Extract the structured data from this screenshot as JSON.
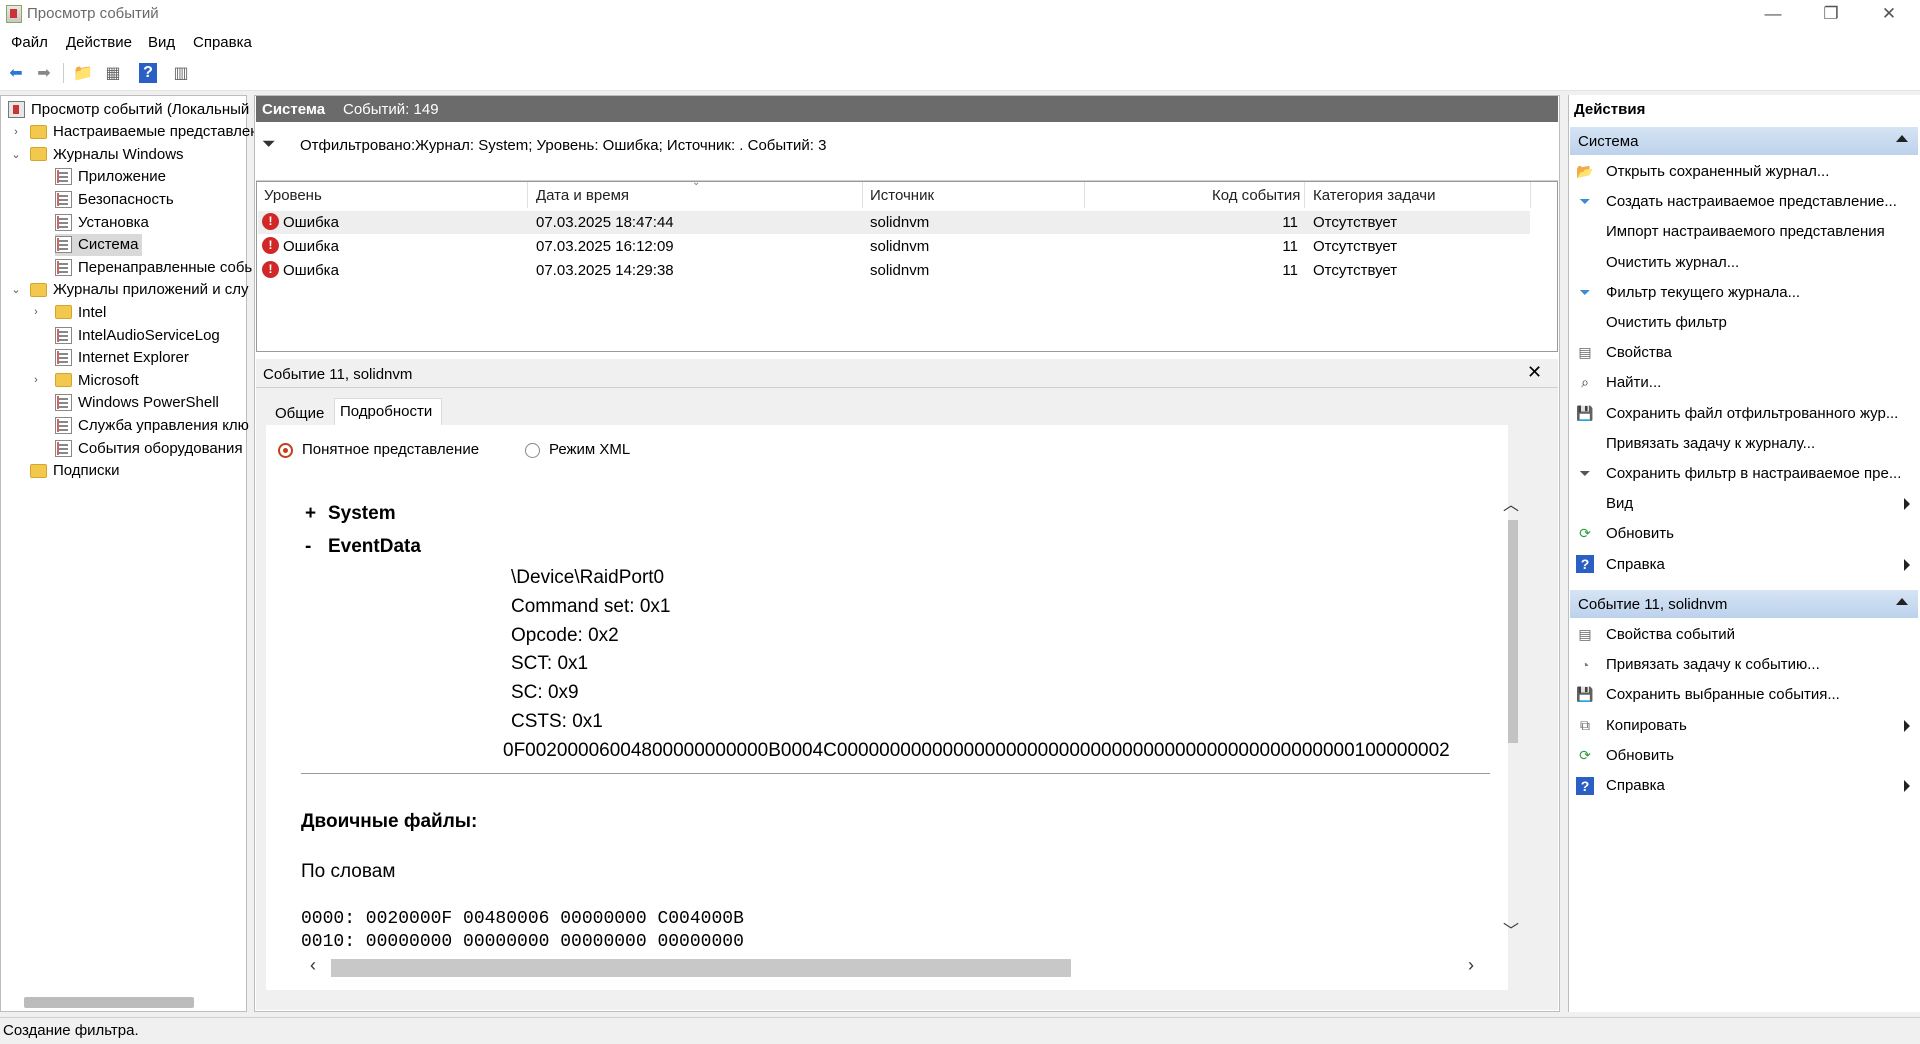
{
  "window": {
    "title": "Просмотр событий"
  },
  "menu": [
    "Файл",
    "Действие",
    "Вид",
    "Справка"
  ],
  "tree": {
    "items": [
      {
        "label": "Просмотр событий (Локальный",
        "depth": 0,
        "icon": "event-viewer-icon",
        "twisty": ""
      },
      {
        "label": "Настраиваемые представлен",
        "depth": 1,
        "icon": "folder-icon",
        "twisty": "›"
      },
      {
        "label": "Журналы Windows",
        "depth": 1,
        "icon": "folder-icon",
        "twisty": "⌄"
      },
      {
        "label": "Приложение",
        "depth": 2,
        "icon": "log-icon",
        "twisty": ""
      },
      {
        "label": "Безопасность",
        "depth": 2,
        "icon": "log-icon",
        "twisty": ""
      },
      {
        "label": "Установка",
        "depth": 2,
        "icon": "log-icon",
        "twisty": ""
      },
      {
        "label": "Система",
        "depth": 2,
        "icon": "log-icon",
        "twisty": "",
        "selected": true
      },
      {
        "label": "Перенаправленные собь",
        "depth": 2,
        "icon": "log-icon",
        "twisty": ""
      },
      {
        "label": "Журналы приложений и слу",
        "depth": 1,
        "icon": "folder-icon",
        "twisty": "⌄"
      },
      {
        "label": "Intel",
        "depth": 2,
        "icon": "folder-icon",
        "twisty": "›"
      },
      {
        "label": "IntelAudioServiceLog",
        "depth": 2,
        "icon": "log-icon",
        "twisty": ""
      },
      {
        "label": "Internet Explorer",
        "depth": 2,
        "icon": "log-icon",
        "twisty": ""
      },
      {
        "label": "Microsoft",
        "depth": 2,
        "icon": "folder-icon",
        "twisty": "›"
      },
      {
        "label": "Windows PowerShell",
        "depth": 2,
        "icon": "log-icon",
        "twisty": ""
      },
      {
        "label": "Служба управления клю",
        "depth": 2,
        "icon": "log-icon",
        "twisty": ""
      },
      {
        "label": "События оборудования",
        "depth": 2,
        "icon": "log-icon",
        "twisty": ""
      },
      {
        "label": "Подписки",
        "depth": 1,
        "icon": "subscriptions-icon",
        "twisty": ""
      }
    ]
  },
  "middle": {
    "title": "Система",
    "count": "Событий: 149",
    "filter": "Отфильтровано:Журнал: System; Уровень: Ошибка; Источник: . Событий: 3",
    "columns": [
      "Уровень",
      "Дата и время",
      "Источник",
      "Код события",
      "Категория задачи"
    ],
    "rows": [
      {
        "level": "Ошибка",
        "date": "07.03.2025 18:47:44",
        "source": "solidnvm",
        "code": "11",
        "category": "Отсутствует"
      },
      {
        "level": "Ошибка",
        "date": "07.03.2025 16:12:09",
        "source": "solidnvm",
        "code": "11",
        "category": "Отсутствует"
      },
      {
        "level": "Ошибка",
        "date": "07.03.2025 14:29:38",
        "source": "solidnvm",
        "code": "11",
        "category": "Отсутствует"
      }
    ]
  },
  "detail": {
    "title": "Событие 11, solidnvm",
    "tabs": [
      "Общие",
      "Подробности"
    ],
    "radio_friendly": "Понятное представление",
    "radio_xml": "Режим XML",
    "system_toggle": "+",
    "system_label": "System",
    "eventdata_toggle": "-",
    "eventdata_label": "EventData",
    "data_lines": [
      "\\Device\\RaidPort0",
      "Command set: 0x1",
      "Opcode: 0x2",
      "SCT: 0x1",
      "SC: 0x9",
      "CSTS: 0x1"
    ],
    "hex_line": "0F00200006004800000000000B0004C0000000000000000000000000000000000000000000000000100000002",
    "binary_heading": "Двоичные файлы:",
    "by_words": "По словам",
    "dump": [
      "0000: 0020000F 00480006 00000000 C004000B",
      "0010: 00000000 00000000 00000000 00000000"
    ]
  },
  "actions": {
    "title": "Действия",
    "section1": "Система",
    "items1": [
      {
        "label": "Открыть сохраненный журнал...",
        "icon": "open-log-icon",
        "arrow": false
      },
      {
        "label": "Создать настраиваемое представление...",
        "icon": "filter-icon",
        "arrow": false
      },
      {
        "label": "Импорт настраиваемого представления",
        "icon": "",
        "arrow": false
      },
      {
        "label": "Очистить журнал...",
        "icon": "",
        "arrow": false
      },
      {
        "label": "Фильтр текущего журнала...",
        "icon": "filter-icon",
        "arrow": false
      },
      {
        "label": "Очистить фильтр",
        "icon": "",
        "arrow": false
      },
      {
        "label": "Свойства",
        "icon": "properties-icon",
        "arrow": false
      },
      {
        "label": "Найти...",
        "icon": "find-icon",
        "arrow": false
      },
      {
        "label": "Сохранить файл отфильтрованного жур...",
        "icon": "save-icon",
        "arrow": false
      },
      {
        "label": "Привязать задачу к журналу...",
        "icon": "",
        "arrow": false
      },
      {
        "label": "Сохранить фильтр в настраиваемое пре...",
        "icon": "save-filter-icon",
        "arrow": false
      },
      {
        "label": "Вид",
        "icon": "",
        "arrow": true
      },
      {
        "label": "Обновить",
        "icon": "refresh-icon",
        "arrow": false
      },
      {
        "label": "Справка",
        "icon": "help-icon",
        "arrow": true
      }
    ],
    "section2": "Событие 11, solidnvm",
    "items2": [
      {
        "label": "Свойства событий",
        "icon": "properties-icon",
        "arrow": false
      },
      {
        "label": "Привязать задачу к событию...",
        "icon": "task-icon",
        "arrow": false
      },
      {
        "label": "Сохранить выбранные события...",
        "icon": "save-icon",
        "arrow": false
      },
      {
        "label": "Копировать",
        "icon": "copy-icon",
        "arrow": true
      },
      {
        "label": "Обновить",
        "icon": "refresh-icon",
        "arrow": false
      },
      {
        "label": "Справка",
        "icon": "help-icon",
        "arrow": true
      }
    ]
  },
  "status": "Создание фильтра."
}
